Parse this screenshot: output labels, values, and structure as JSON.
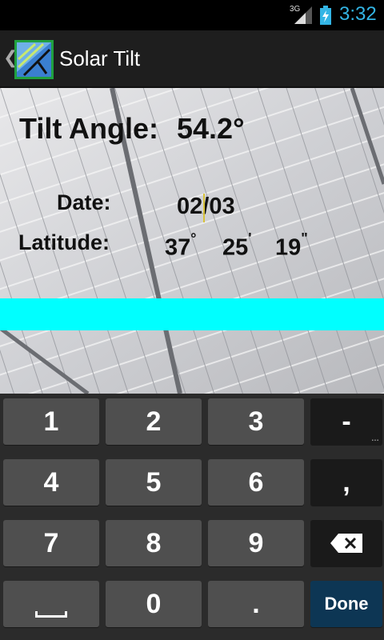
{
  "status_bar": {
    "network": "3G",
    "time": "3:32",
    "colors": {
      "time": "#33b5e5",
      "battery": "#33b5e5"
    }
  },
  "action_bar": {
    "up_icon": "chevron-left-icon",
    "app_icon": "solar-panel-icon",
    "title": "Solar Tilt"
  },
  "content": {
    "tilt_label": "Tilt Angle:",
    "tilt_value": "54.2°",
    "date_label": "Date:",
    "date_value": "02/03",
    "latitude_label": "Latitude:",
    "latitude": {
      "degrees": "37",
      "deg_mark": "°",
      "minutes": "25",
      "min_mark": "'",
      "seconds": "19",
      "sec_mark": "\""
    },
    "band_color": "#00ffff"
  },
  "keyboard": {
    "row1": [
      "1",
      "2",
      "3",
      "-"
    ],
    "row2": [
      "4",
      "5",
      "6",
      ","
    ],
    "row3": [
      "7",
      "8",
      "9"
    ],
    "row4": [
      "0",
      "."
    ],
    "delete_icon": "backspace-icon",
    "space_icon": "space-icon",
    "done_label": "Done",
    "colors": {
      "key": "#4f4f4f",
      "done": "#0d3654"
    }
  }
}
